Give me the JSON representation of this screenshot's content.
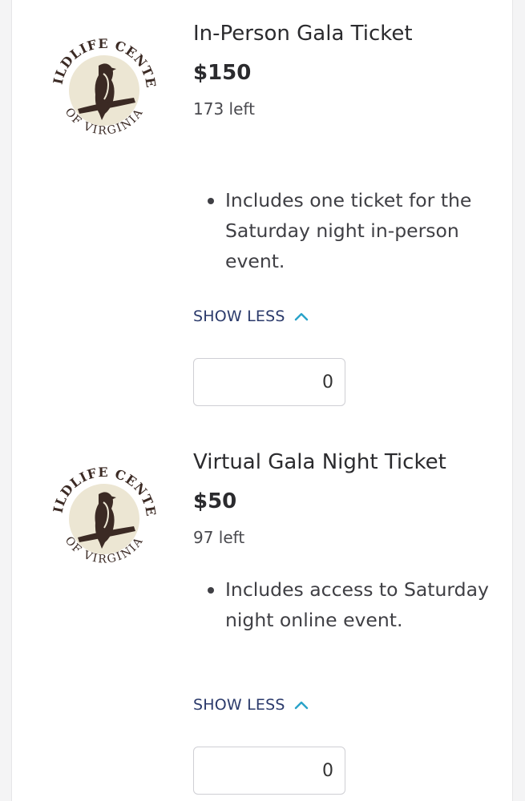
{
  "tickets": [
    {
      "logo_text_top": "WILDLIFE CENTER",
      "logo_text_bottom": "OF VIRGINIA",
      "title": "In-Person Gala Ticket",
      "price": "$150",
      "remaining": "173 left",
      "description": [
        "Includes one ticket for the Saturday night in-person event."
      ],
      "toggle_label": "SHOW LESS",
      "quantity": "0"
    },
    {
      "logo_text_top": "WILDLIFE CENTER",
      "logo_text_bottom": "OF VIRGINIA",
      "title": "Virtual Gala Night Ticket",
      "price": "$50",
      "remaining": "97 left",
      "description": [
        "Includes access to Saturday night online event."
      ],
      "toggle_label": "SHOW LESS",
      "quantity": "0"
    }
  ],
  "colors": {
    "link": "#2b3a6b",
    "chevron": "#2aa3c9",
    "logo_disc": "#ece6d3",
    "logo_ink": "#3b2a24"
  },
  "icons": {
    "logo": "wildlife-center-hawk-logo",
    "toggle": "chevron-up-icon"
  }
}
